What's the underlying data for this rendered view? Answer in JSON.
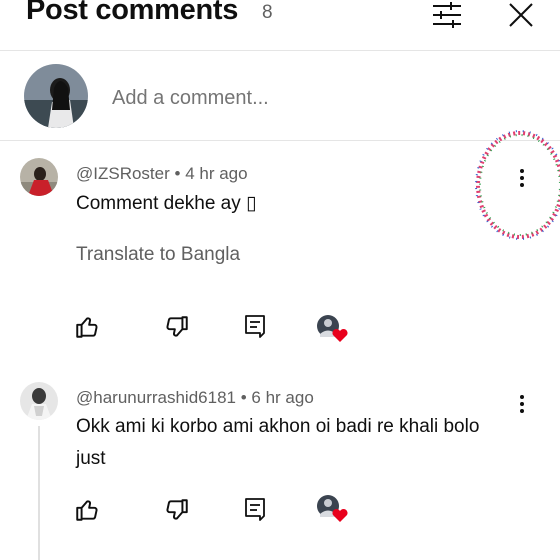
{
  "header": {
    "title": "Post comments",
    "count": "8"
  },
  "composer": {
    "placeholder": "Add a comment..."
  },
  "comments": [
    {
      "author": "@IZSRoster",
      "time": "4 hr ago",
      "text": "Comment dekhe ay ▯",
      "translate": "Translate to Bangla"
    },
    {
      "author": "@harunurrashid6181",
      "time": "6 hr ago",
      "text": "Okk ami ki korbo ami akhon oi badi re khali bolo just"
    }
  ],
  "colors": {
    "heart": "#e8001c",
    "text": "#0f0f0f",
    "secondary": "#606060"
  }
}
